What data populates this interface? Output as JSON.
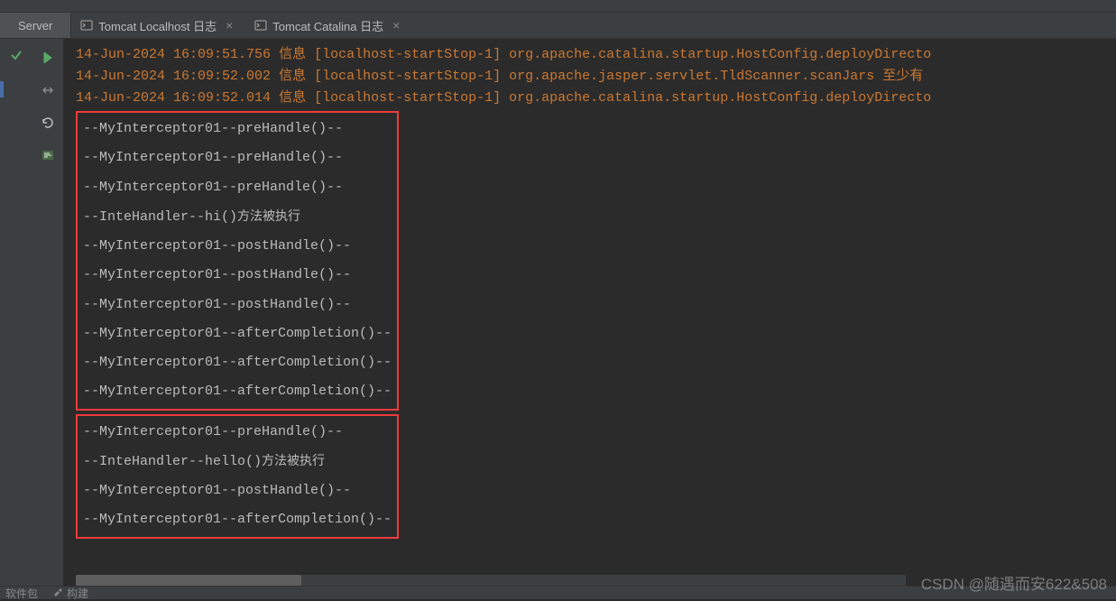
{
  "tabs": {
    "server": "Server",
    "localhost": "Tomcat Localhost 日志",
    "catalina": "Tomcat Catalina 日志"
  },
  "log_entries": [
    {
      "ts": "14-Jun-2024 16:09:51.756",
      "lvl": "信息",
      "thread": "[localhost-startStop-1]",
      "cls": "org.apache.catalina.startup.HostConfig.deployDirecto"
    },
    {
      "ts": "14-Jun-2024 16:09:52.002",
      "lvl": "信息",
      "thread": "[localhost-startStop-1]",
      "cls": "org.apache.jasper.servlet.TldScanner.scanJars",
      "tail": " 至少有"
    },
    {
      "ts": "14-Jun-2024 16:09:52.014",
      "lvl": "信息",
      "thread": "[localhost-startStop-1]",
      "cls": "org.apache.catalina.startup.HostConfig.deployDirecto"
    }
  ],
  "box1": [
    {
      "t": "--MyInterceptor01--preHandle()--"
    },
    {
      "t": "--MyInterceptor01--preHandle()--"
    },
    {
      "t": "--MyInterceptor01--preHandle()--"
    },
    {
      "t": "--InteHandler--hi()",
      "cn": "方法被执行"
    },
    {
      "t": "--MyInterceptor01--postHandle()--"
    },
    {
      "t": "--MyInterceptor01--postHandle()--"
    },
    {
      "t": "--MyInterceptor01--postHandle()--"
    },
    {
      "t": "--MyInterceptor01--afterCompletion()--"
    },
    {
      "t": "--MyInterceptor01--afterCompletion()--"
    },
    {
      "t": "--MyInterceptor01--afterCompletion()--"
    }
  ],
  "box2": [
    {
      "t": "--MyInterceptor01--preHandle()--"
    },
    {
      "t": "--InteHandler--hello()",
      "cn": "方法被执行"
    },
    {
      "t": "--MyInterceptor01--postHandle()--"
    },
    {
      "t": "--MyInterceptor01--afterCompletion()--"
    }
  ],
  "bottom": {
    "pkg": "软件包",
    "build": "构建"
  },
  "watermark": "CSDN @随遇而安622&508"
}
